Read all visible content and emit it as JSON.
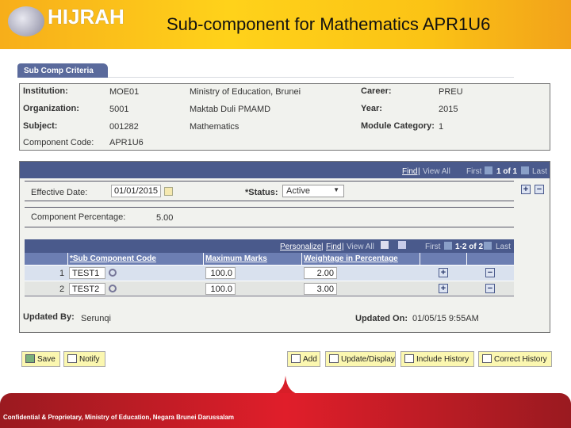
{
  "header": {
    "logo_text": "HIJRAH",
    "title": "Sub-component for Mathematics APR1U6"
  },
  "tab": {
    "label": "Sub Comp Criteria"
  },
  "criteria": {
    "institution_label": "Institution:",
    "institution_code": "MOE01",
    "institution_name": "Ministry of Education, Brunei",
    "organization_label": "Organization:",
    "organization_code": "5001",
    "organization_name": "Maktab Duli PMAMD",
    "subject_label": "Subject:",
    "subject_code": "001282",
    "subject_name": "Mathematics",
    "component_label": "Component Code:",
    "component_code": "APR1U6",
    "career_label": "Career:",
    "career_value": "PREU",
    "year_label": "Year:",
    "year_value": "2015",
    "module_label": "Module Category:",
    "module_value": "1"
  },
  "panel": {
    "nav": {
      "find": "Find",
      "sep": "|",
      "view_all": "View All",
      "first": "First",
      "count": "1 of 1",
      "last": "Last"
    },
    "effective_date_label": "Effective Date:",
    "effective_date_value": "01/01/2015",
    "status_label": "*Status:",
    "status_value": "Active",
    "component_pct_label": "Component Percentage:",
    "component_pct_value": "5.00",
    "updated_by_label": "Updated By:",
    "updated_by_value": "Serunqi",
    "updated_on_label": "Updated On:",
    "updated_on_value": "01/05/15  9:55AM"
  },
  "grid": {
    "nav": {
      "personalize": "Personalize",
      "find": "Find",
      "view_all": "View All",
      "sep": "|",
      "first": "First",
      "count": "1-2 of 2",
      "last": "Last"
    },
    "columns": [
      "*Sub Component Code",
      "Maximum Marks",
      "Weightage in Percentage"
    ],
    "rows": [
      {
        "num": "1",
        "code": "TEST1",
        "max": "100.0",
        "weight": "2.00"
      },
      {
        "num": "2",
        "code": "TEST2",
        "max": "100.0",
        "weight": "3.00"
      }
    ]
  },
  "buttons": {
    "save": "Save",
    "notify": "Notify",
    "add": "Add",
    "update_display": "Update/Display",
    "include_history": "Include History",
    "correct_history": "Correct History"
  },
  "footer": {
    "text": "Confidential & Proprietary, Ministry of Education, Negara Brunei Darussalam"
  }
}
